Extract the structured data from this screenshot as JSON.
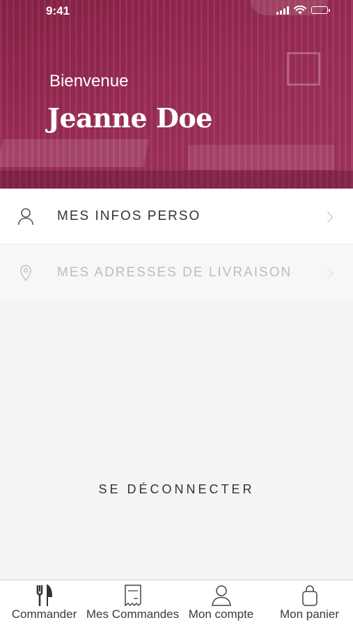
{
  "status_bar": {
    "time": "9:41"
  },
  "header": {
    "greeting": "Bienvenue",
    "user_name": "Jeanne Doe"
  },
  "menu": {
    "items": [
      {
        "label": "MES INFOS PERSO",
        "icon": "user-icon",
        "enabled": true
      },
      {
        "label": "MES ADRESSES DE LIVRAISON",
        "icon": "location-pin-icon",
        "enabled": false
      }
    ]
  },
  "logout_label": "SE DÉCONNECTER",
  "tabbar": {
    "tabs": [
      {
        "label": "Commander",
        "icon": "fork-knife-icon"
      },
      {
        "label": "Mes Commandes",
        "icon": "receipt-icon"
      },
      {
        "label": "Mon compte",
        "icon": "user-icon"
      },
      {
        "label": "Mon panier",
        "icon": "shopping-bag-icon"
      }
    ]
  },
  "colors": {
    "brand": "#9c2c55",
    "background": "#f4f4f4",
    "text": "#333333",
    "disabled_text": "#bdbdbd"
  }
}
